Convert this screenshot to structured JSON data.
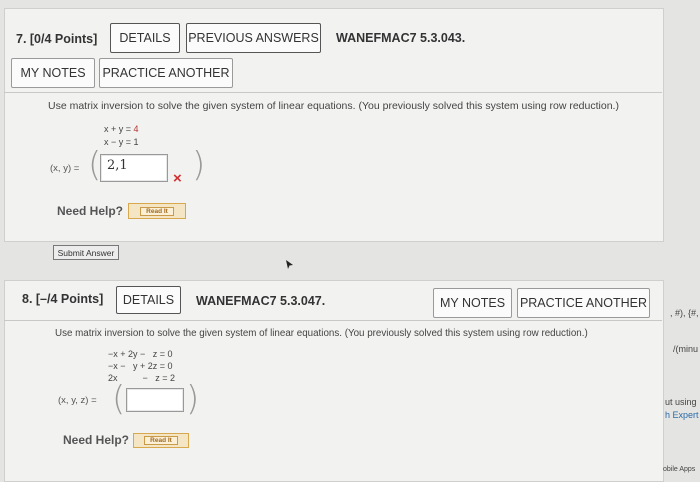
{
  "q7": {
    "title": "7. [0/4 Points]",
    "details_label": "DETAILS",
    "previous_answers_label": "PREVIOUS ANSWERS",
    "code": "WANEFMAC7 5.3.043.",
    "my_notes_label": "MY NOTES",
    "practice_label": "PRACTICE ANOTHER",
    "instructions": "Use matrix inversion to solve the given system of linear equations. (You previously solved this system using row reduction.)",
    "eq1_lhs": "x + y =",
    "eq1_rhs": "4",
    "eq2_lhs": "x − y =",
    "eq2_rhs": "1",
    "answer_label": "(x, y) =",
    "answer_value": "2,1",
    "status_mark": "×",
    "need_help": "Need Help?",
    "read_it": "Read It",
    "submit_label": "Submit Answer"
  },
  "q8": {
    "title": "8. [–/4 Points]",
    "details_label": "DETAILS",
    "code": "WANEFMAC7 5.3.047.",
    "my_notes_label": "MY NOTES",
    "practice_label": "PRACTICE ANOTHER",
    "instructions": "Use matrix inversion to solve the given system of linear equations. (You previously solved this system using row reduction.)",
    "eq1": "−x + 2y −   z = 0",
    "eq2": "−x −   y + 2z = 0",
    "eq3": "2x          −   z = 2",
    "answer_label": "(x, y, z) =",
    "answer_value": "",
    "need_help": "Need Help?",
    "read_it": "Read It"
  },
  "right_snippets": {
    "s1": ", #), {#,",
    "s2": "/(minu",
    "s3": "ut using",
    "s4": "h Expert",
    "s5": "obile Apps"
  },
  "colors": {
    "accent_read_it": "#d8a84e",
    "incorrect": "#d23030"
  }
}
